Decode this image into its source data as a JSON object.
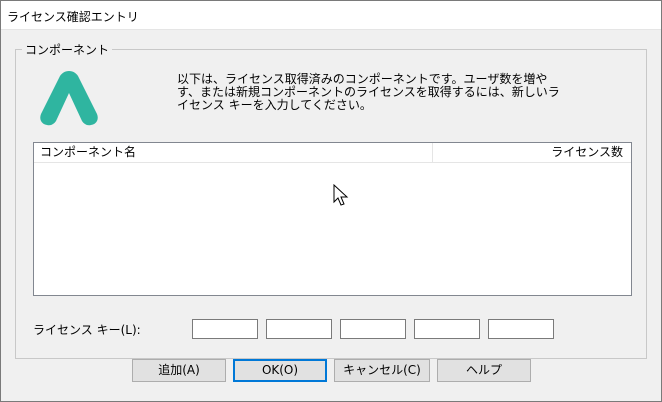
{
  "window": {
    "title": "ライセンス確認エントリ"
  },
  "group": {
    "label": "コンポーネント"
  },
  "logo": {
    "color": "#2fb5a0",
    "icon": "license-logo"
  },
  "description": "以下は、ライセンス取得済みのコンポーネントです。ユーザ数を増や\nす、または新規コンポーネントのライセンスを取得するには、新しいラ\nイセンス キーを入力してください。",
  "list": {
    "columns": {
      "name": "コンポーネント名",
      "count": "ライセンス数"
    },
    "rows": []
  },
  "license_key": {
    "label": "ライセンス キー(L):",
    "fields": [
      "",
      "",
      "",
      "",
      ""
    ]
  },
  "buttons": {
    "add": "追加(A)",
    "ok": "OK(O)",
    "cancel": "キャンセル(C)",
    "help": "ヘルプ"
  },
  "colors": {
    "accent": "#0078d7",
    "background": "#f0f0f0"
  }
}
